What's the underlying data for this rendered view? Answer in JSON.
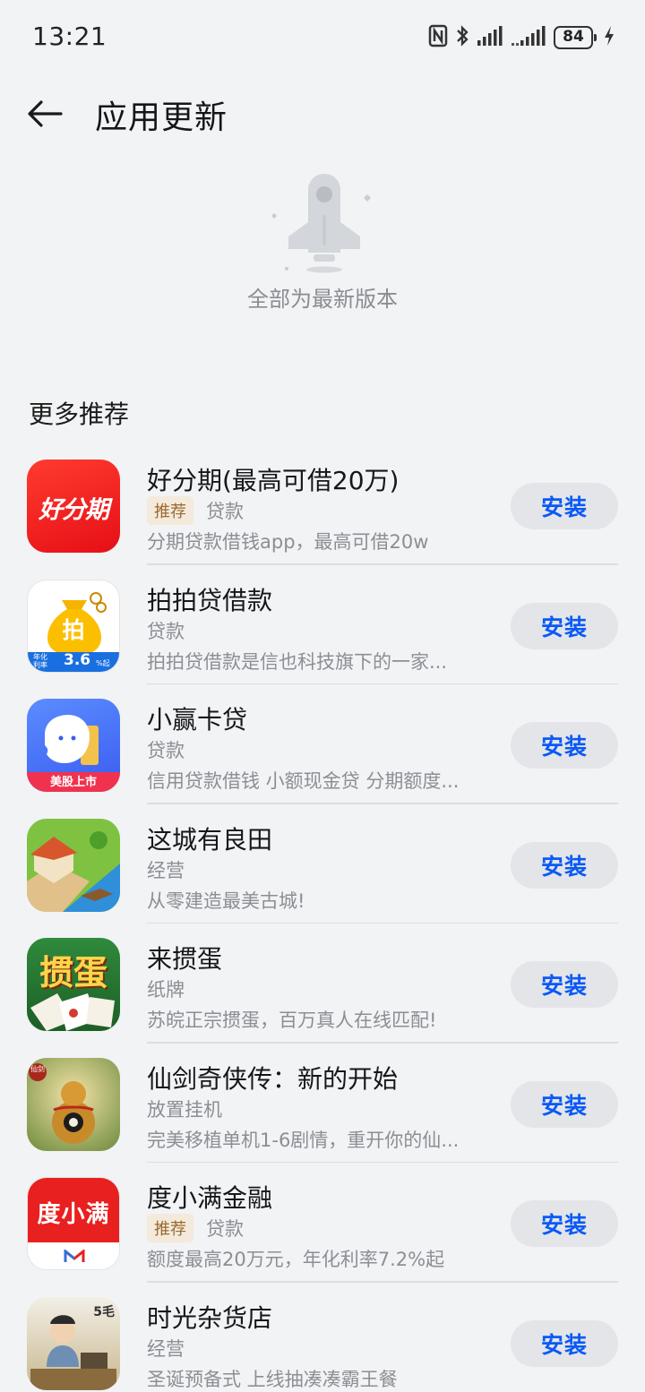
{
  "status": {
    "time": "13:21",
    "battery": "84",
    "icons": [
      "nfc-icon",
      "bluetooth-icon",
      "signal-icon",
      "signal-2-icon",
      "battery-icon",
      "charging-icon"
    ]
  },
  "header": {
    "title": "应用更新",
    "back_icon": "back-arrow-icon"
  },
  "empty_state": {
    "message": "全部为最新版本",
    "icon": "rocket-icon"
  },
  "recommend": {
    "title": "更多推荐",
    "apps": [
      {
        "name": "好分期(最高可借20万)",
        "badge": "推荐",
        "category": "贷款",
        "desc": "分期贷款借钱app，最高可借20w",
        "button": "安装",
        "icon_text": "好分期"
      },
      {
        "name": "拍拍贷借款",
        "badge": "",
        "category": "贷款",
        "desc": "拍拍贷借款是信也科技旗下的一家...",
        "button": "安装",
        "icon_text": "拍",
        "icon_sub_1": "年化",
        "icon_sub_2": "利率",
        "icon_sub_3": "3.6",
        "icon_sub_4": "%起"
      },
      {
        "name": "小赢卡贷",
        "badge": "",
        "category": "贷款",
        "desc": "信用贷款借钱 小额现金贷 分期额度...",
        "button": "安装",
        "icon_text": "美股上市"
      },
      {
        "name": "这城有良田",
        "badge": "",
        "category": "经营",
        "desc": "从零建造最美古城!",
        "button": "安装"
      },
      {
        "name": "来掼蛋",
        "badge": "",
        "category": "纸牌",
        "desc": "苏皖正宗掼蛋，百万真人在线匹配!",
        "button": "安装",
        "icon_text": "掼蛋"
      },
      {
        "name": "仙剑奇侠传：新的开始",
        "badge": "",
        "category": "放置挂机",
        "desc": "完美移植单机1-6剧情，重开你的仙...",
        "button": "安装",
        "icon_text": "仙剑"
      },
      {
        "name": "度小满金融",
        "badge": "推荐",
        "category": "贷款",
        "desc": "额度最高20万元，年化利率7.2%起",
        "button": "安装",
        "icon_text": "度小满"
      },
      {
        "name": "时光杂货店",
        "badge": "",
        "category": "经营",
        "desc": "圣诞预备式 上线抽凑凑霸王餐",
        "button": "安装",
        "icon_text": "5毛"
      }
    ]
  }
}
